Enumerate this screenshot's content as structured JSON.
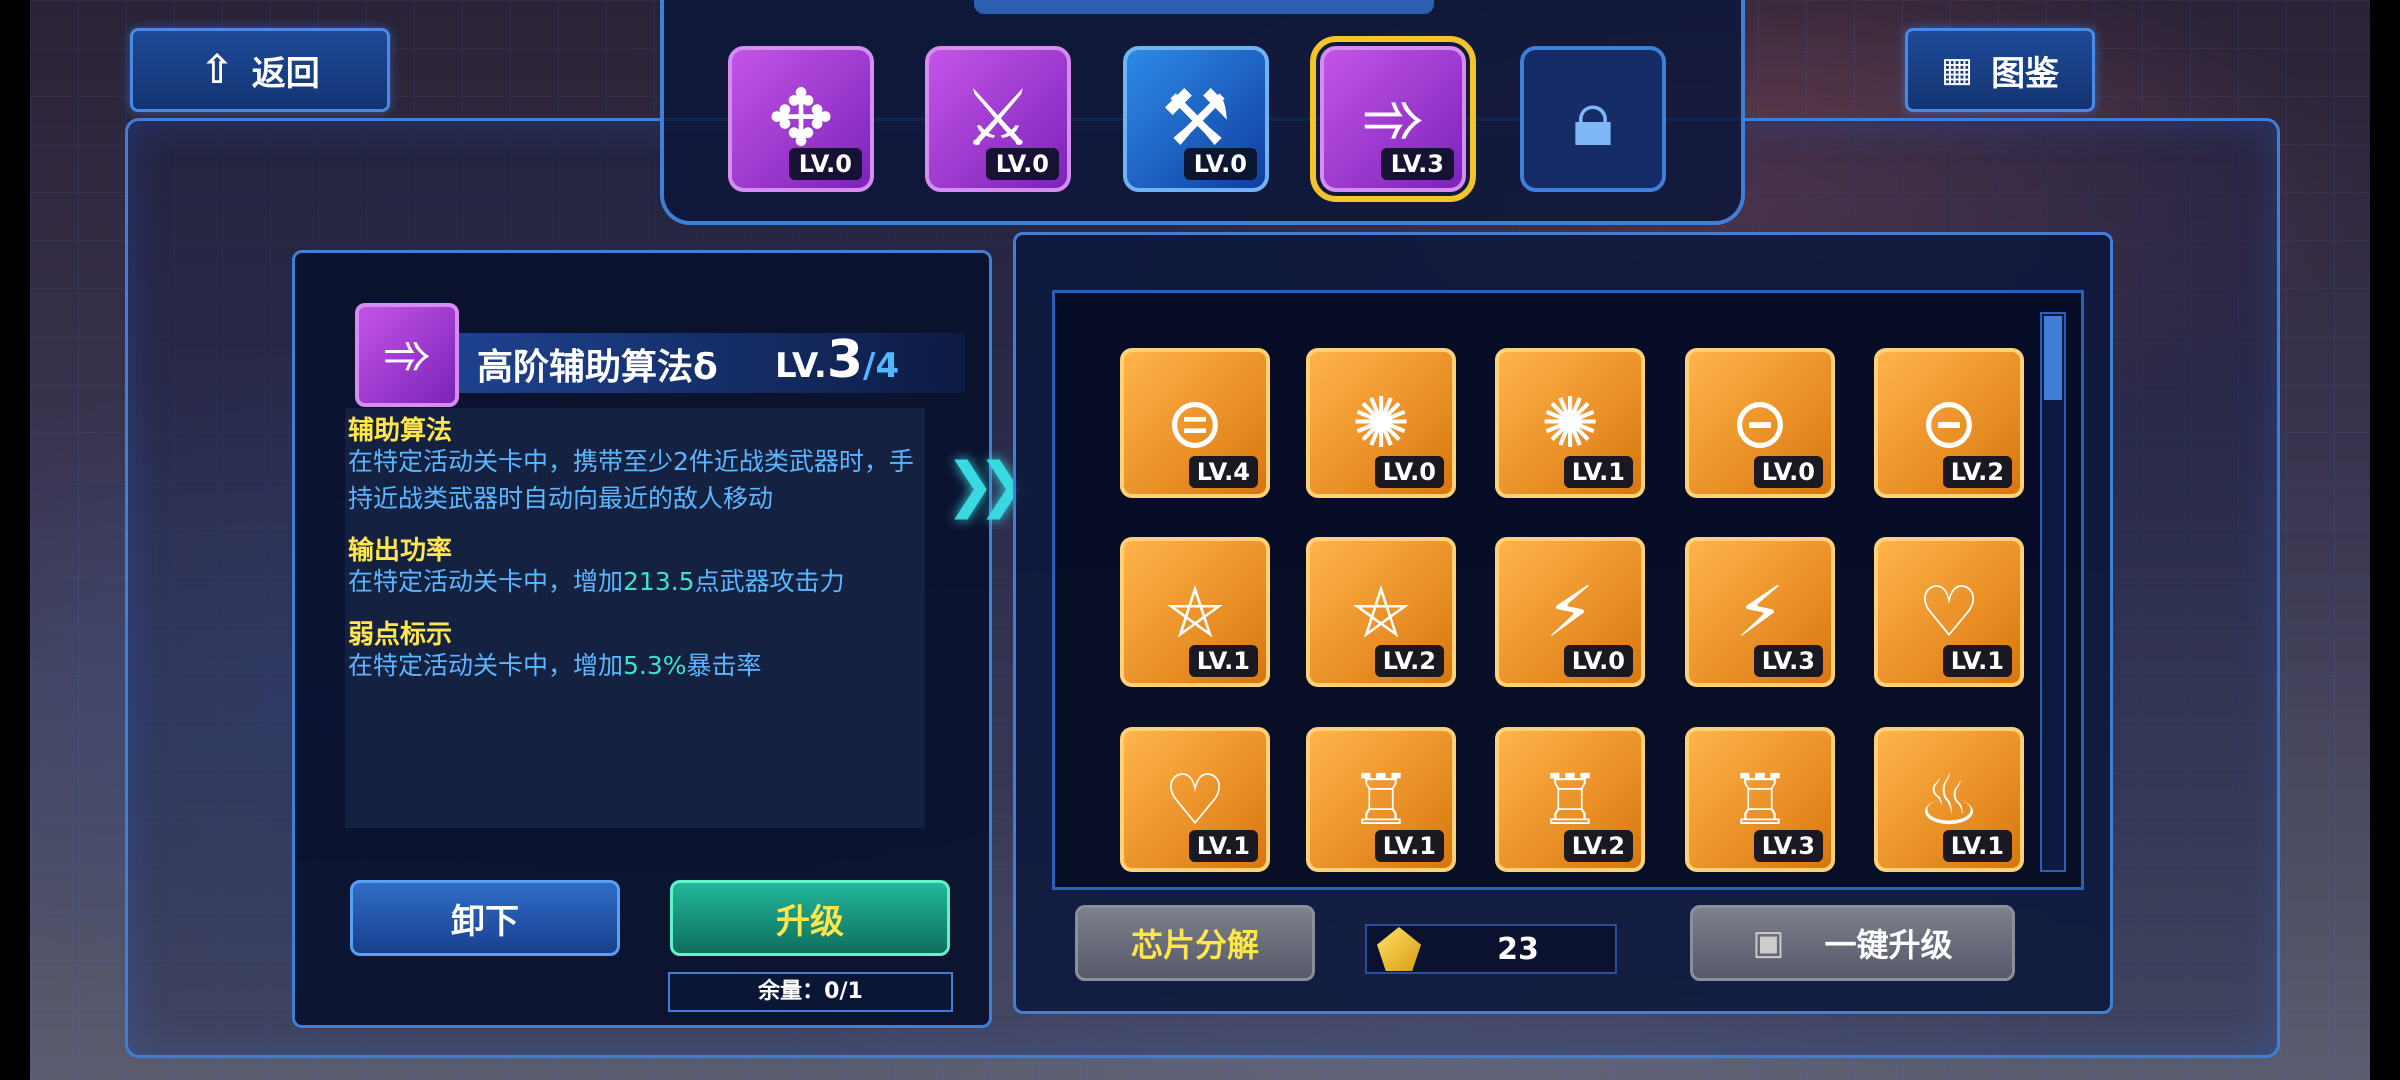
{
  "nav": {
    "back_label": "返回",
    "back_icon": "home-up-arrow-icon",
    "codex_label": "图鉴",
    "codex_icon": "grid-icon"
  },
  "tabs": [
    {
      "icon": "arrows-cross-icon",
      "level": "LV.0",
      "color": "purple"
    },
    {
      "icon": "sword-slash-icon",
      "level": "LV.0",
      "color": "purple"
    },
    {
      "icon": "axe-icon",
      "level": "LV.0",
      "color": "blue"
    },
    {
      "icon": "axe-arrow-icon",
      "level": "LV.3",
      "color": "purple",
      "selected": true
    },
    {
      "icon": "lock-icon",
      "locked": true
    }
  ],
  "detail": {
    "name": "高阶辅助算法δ",
    "level_prefix": "LV.",
    "level_current": "3",
    "level_max": "/4",
    "sections": [
      {
        "title": "辅助算法",
        "text": "在特定活动关卡中，携带至少2件近战类武器时，手持近战类武器时自动向最近的敌人移动"
      },
      {
        "title": "输出功率",
        "text_pre": "在特定活动关卡中，增加",
        "highlight": "213.5",
        "text_post": "点武器攻击力"
      },
      {
        "title": "弱点标示",
        "text_pre": "在特定活动关卡中，增加",
        "highlight": "5.3%",
        "text_post": "暴击率"
      }
    ],
    "unequip_label": "卸下",
    "upgrade_label": "升级",
    "remain_label": "余量：0/1"
  },
  "chips": [
    {
      "icon": "gauge-bars-icon",
      "level": "LV.4"
    },
    {
      "icon": "swirl-icon",
      "level": "LV.0"
    },
    {
      "icon": "swirl-icon",
      "level": "LV.1"
    },
    {
      "icon": "gauge-icon",
      "level": "LV.0"
    },
    {
      "icon": "gauge-icon",
      "level": "LV.2"
    },
    {
      "icon": "pentagram-icon",
      "level": "LV.1"
    },
    {
      "icon": "pentagram-icon",
      "level": "LV.2"
    },
    {
      "icon": "lightning-icon",
      "level": "LV.0"
    },
    {
      "icon": "lightning-icon",
      "level": "LV.3"
    },
    {
      "icon": "heart-potion-icon",
      "level": "LV.1"
    },
    {
      "icon": "heart-potion-icon",
      "level": "LV.1"
    },
    {
      "icon": "potion-bars-icon",
      "level": "LV.1"
    },
    {
      "icon": "potion-icon",
      "level": "LV.2"
    },
    {
      "icon": "potion-icon",
      "level": "LV.3"
    },
    {
      "icon": "flame-icon",
      "level": "LV.1"
    }
  ],
  "footer": {
    "decompose_label": "芯片分解",
    "currency_icon": "yellow-gem-icon",
    "currency_value": "23",
    "one_click_label": "一键升级",
    "one_click_icon": "chip-icon"
  }
}
